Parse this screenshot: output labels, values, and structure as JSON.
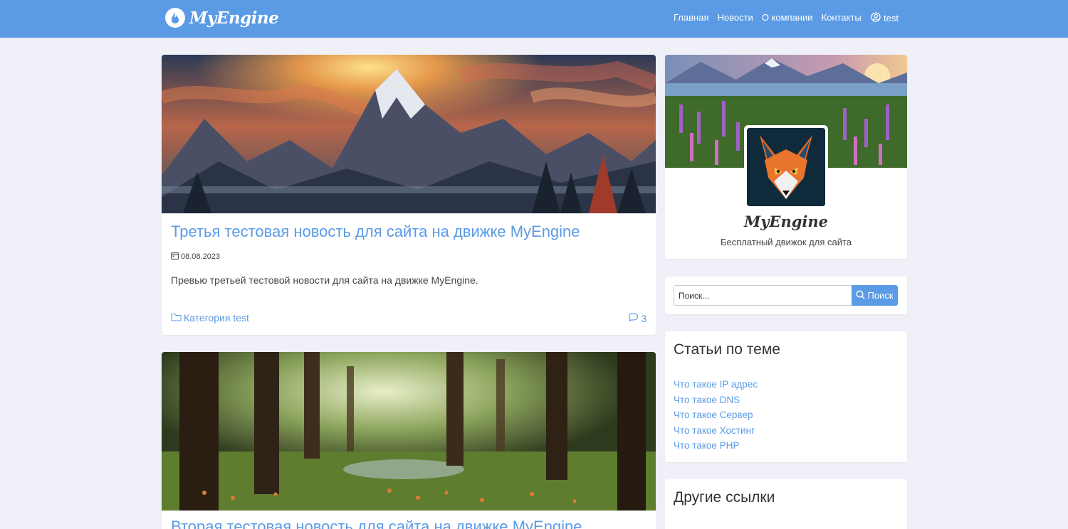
{
  "header": {
    "logo_text": "MyEngine",
    "nav": [
      "Главная",
      "Новости",
      "О компании",
      "Контакты"
    ],
    "user": "test"
  },
  "posts": [
    {
      "title": "Третья тестовая новость для сайта на движке MyEngine",
      "date": "08.08.2023",
      "preview": "Превью третьей тестовой новости для сайта на движке MyEngine.",
      "category": "Категория test",
      "comments": "3"
    },
    {
      "title": "Вторая тестовая новость для сайта на движке MyEngine"
    }
  ],
  "profile": {
    "name": "MyEngine",
    "subtitle": "Бесплатный движок для сайта"
  },
  "search": {
    "placeholder": "Поиск...",
    "button": "Поиск"
  },
  "related": {
    "title": "Статьи по теме",
    "links": [
      "Что такое IP адрес",
      "Что такое DNS",
      "Что такое Сервер",
      "Что такое Хостинг",
      "Что такое PHP"
    ]
  },
  "other": {
    "title": "Другие ссылки"
  },
  "colors": {
    "accent": "#5b9be6",
    "background": "#f0f1f8"
  }
}
